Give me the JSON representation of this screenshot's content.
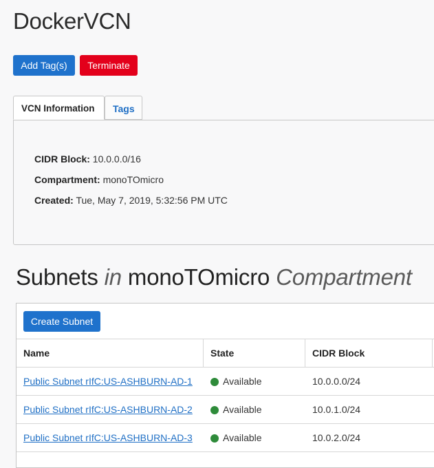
{
  "page": {
    "title": "DockerVCN"
  },
  "actions": {
    "add_tags": "Add Tag(s)",
    "terminate": "Terminate"
  },
  "tabs": [
    {
      "label": "VCN Information",
      "active": true
    },
    {
      "label": "Tags",
      "active": false
    }
  ],
  "vcn_info": {
    "cidr_label": "CIDR Block:",
    "cidr_value": "10.0.0.0/16",
    "compartment_label": "Compartment:",
    "compartment_value": "monoTOmicro",
    "created_label": "Created:",
    "created_value": "Tue, May 7, 2019, 5:32:56 PM UTC"
  },
  "subnets": {
    "title_prefix": "Subnets ",
    "title_in": "in",
    "title_compartment": " monoTOmicro ",
    "title_suffix": "Compartment",
    "create_label": "Create Subnet",
    "columns": [
      "Name",
      "State",
      "CIDR Block"
    ],
    "rows": [
      {
        "name": "Public Subnet rIfC:US-ASHBURN-AD-1",
        "state": "Available",
        "cidr": "10.0.0.0/24"
      },
      {
        "name": "Public Subnet rIfC:US-ASHBURN-AD-2",
        "state": "Available",
        "cidr": "10.0.1.0/24"
      },
      {
        "name": "Public Subnet rIfC:US-ASHBURN-AD-3",
        "state": "Available",
        "cidr": "10.0.2.0/24"
      }
    ]
  },
  "colors": {
    "primary": "#1f72cc",
    "danger": "#e3001b",
    "available": "#2e8b3a",
    "link": "#1f6fc5"
  }
}
